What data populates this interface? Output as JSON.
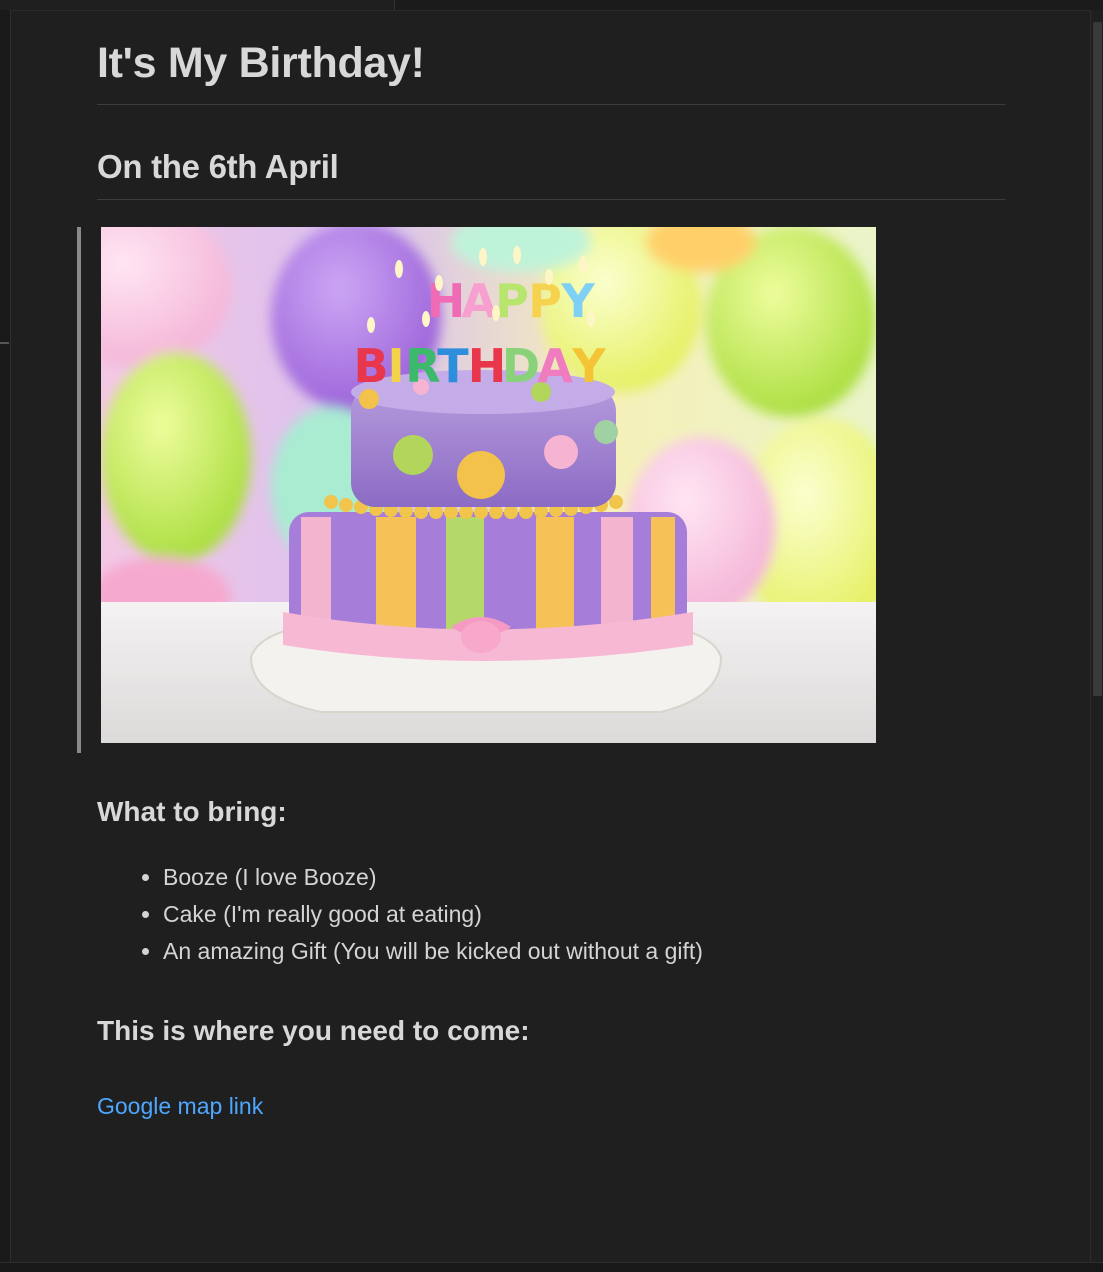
{
  "document": {
    "title": "It's My Birthday!",
    "date_heading": "On the 6th April",
    "image": {
      "icon_name": "birthday-cake-image",
      "candle_text_line1": "HAPPY",
      "candle_text_line2": "BIRTHDAY"
    },
    "bring_heading": "What to bring:",
    "bring_items": [
      "Booze (I love Booze)",
      "Cake (I'm really good at eating)",
      "An amazing Gift (You will be kicked out without a gift)"
    ],
    "where_heading": "This is where you need to come:",
    "map_link_label": "Google map link"
  },
  "colors": {
    "background": "#1f1f1f",
    "text": "#d4d4d4",
    "link": "#4ea7ff",
    "blockquote_border": "#8a8a8a"
  }
}
